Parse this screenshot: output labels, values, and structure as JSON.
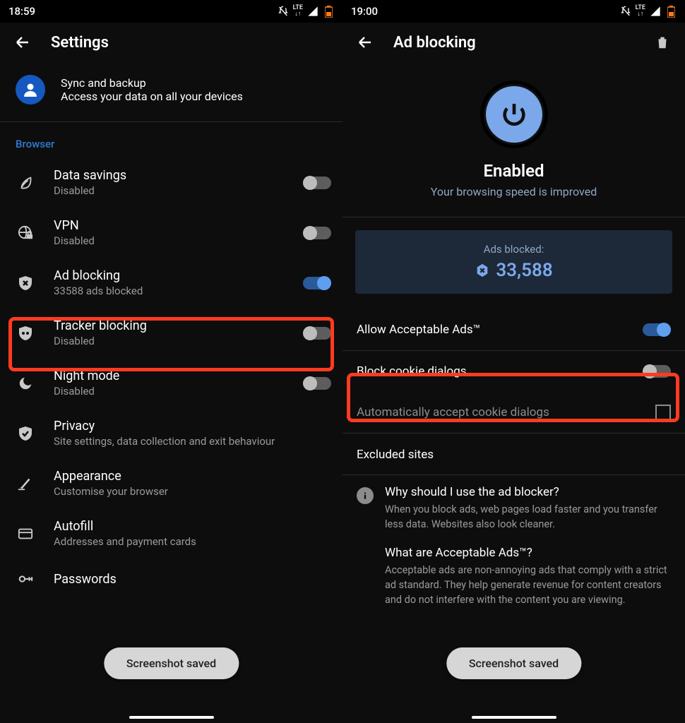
{
  "left": {
    "status_time": "18:59",
    "lte": "LTE",
    "appbar_title": "Settings",
    "sync": {
      "title": "Sync and backup",
      "sub": "Access your data on all your devices"
    },
    "section_browser": "Browser",
    "rows": {
      "data_savings": {
        "title": "Data savings",
        "sub": "Disabled"
      },
      "vpn": {
        "title": "VPN",
        "sub": "Disabled"
      },
      "ad_blocking": {
        "title": "Ad blocking",
        "sub": "33588 ads blocked"
      },
      "tracker": {
        "title": "Tracker blocking",
        "sub": "Disabled"
      },
      "night": {
        "title": "Night mode",
        "sub": "Disabled"
      },
      "privacy": {
        "title": "Privacy",
        "sub": "Site settings, data collection and exit behaviour"
      },
      "appearance": {
        "title": "Appearance",
        "sub": "Customise your browser"
      },
      "autofill": {
        "title": "Autofill",
        "sub": "Addresses and payment cards"
      },
      "passwords": {
        "title": "Passwords"
      }
    },
    "toast": "Screenshot saved"
  },
  "right": {
    "status_time": "19:00",
    "lte": "LTE",
    "appbar_title": "Ad blocking",
    "enabled_title": "Enabled",
    "enabled_sub": "Your browsing speed is improved",
    "stat_label": "Ads blocked:",
    "stat_value": "33,588",
    "rows": {
      "acceptable": "Allow Acceptable Ads™",
      "cookie": "Block cookie dialogs",
      "auto_cookie": "Automatically accept cookie dialogs",
      "excluded": "Excluded sites"
    },
    "faq": {
      "q1": "Why should I use the ad blocker?",
      "a1": "When you block ads, web pages load faster and you transfer less data. Websites also look cleaner.",
      "q2": "What are Acceptable Ads™?",
      "a2": "Acceptable ads are non-annoying ads that comply with a strict ad standard. They help generate revenue for content creators and do not interfere with the content you are viewing."
    },
    "toast": "Screenshot saved"
  }
}
